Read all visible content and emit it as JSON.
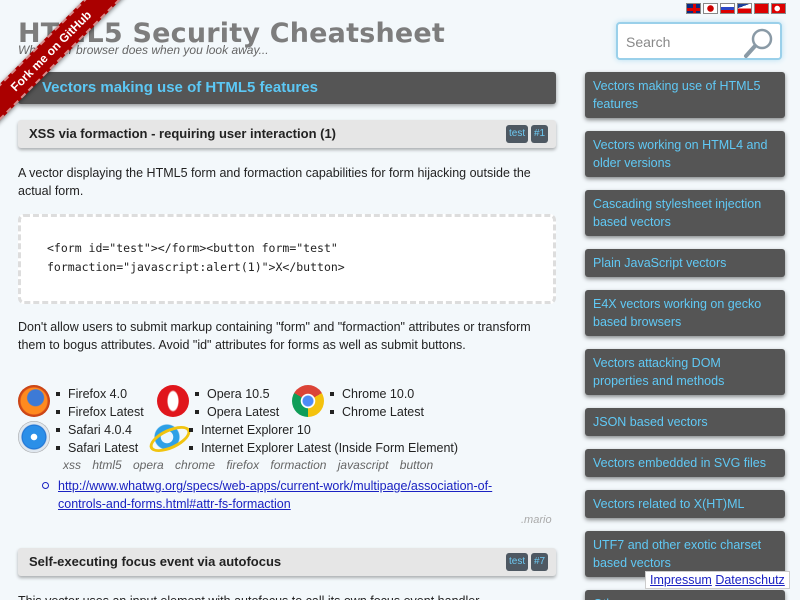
{
  "header": {
    "title": "HTML5 Security Cheatsheet",
    "subtitle": "What your browser does when you look away...",
    "ribbon": "Fork me on GitHub",
    "flags": [
      "English",
      "Japanese",
      "Russian",
      "Czech",
      "Chinese",
      "Turkish"
    ]
  },
  "search": {
    "placeholder": "Search",
    "value": "",
    "icon": "search-icon"
  },
  "main": {
    "section_title": "Vectors making use of HTML5 features",
    "vector1": {
      "title": "XSS via formaction - requiring user interaction (1)",
      "tag_test": "test",
      "tag_id": "#1",
      "description": "A vector displaying the HTML5 form and formaction capabilities for form hijacking outside the actual form.",
      "code_line1": "<form id=\"test\"></form><button form=\"test\"",
      "code_line2": "formaction=\"javascript:alert(1)\">X</button>",
      "advice": "Don't allow users to submit markup containing \"form\" and \"formaction\" attributes or transform them to bogus attributes. Avoid \"id\" attributes for forms as well as submit buttons.",
      "browsers": {
        "firefox": [
          "Firefox 4.0",
          "Firefox Latest"
        ],
        "opera": [
          "Opera 10.5",
          "Opera Latest"
        ],
        "chrome": [
          "Chrome 10.0",
          "Chrome Latest"
        ],
        "safari": [
          "Safari 4.0.4",
          "Safari Latest"
        ],
        "ie": [
          "Internet Explorer 10",
          "Internet Explorer Latest (Inside Form Element)"
        ]
      },
      "keywords": "xss html5 opera chrome firefox formaction javascript button",
      "link_line1": "http://www.whatwg.org/specs/web-apps/current-work/multipage/association-of-",
      "link_line2": "controls-and-forms.html#attr-fs-formaction",
      "author": ".mario"
    },
    "vector2": {
      "title": "Self-executing focus event via autofocus",
      "tag_test": "test",
      "tag_id": "#7",
      "description": "This vector uses an input element with autofocus to call its own focus event handler"
    }
  },
  "sidebar": {
    "items": [
      {
        "label": "Vectors making use of HTML5 features"
      },
      {
        "label": "Vectors working on HTML4 and older versions"
      },
      {
        "label": "Cascading stylesheet injection based vectors"
      },
      {
        "label": "Plain JavaScript vectors"
      },
      {
        "label": "E4X vectors working on gecko based browsers"
      },
      {
        "label": "Vectors attacking DOM properties and methods"
      },
      {
        "label": "JSON based vectors"
      },
      {
        "label": "Vectors embedded in SVG files"
      },
      {
        "label": "Vectors related to X(HT)ML"
      },
      {
        "label": "UTF7 and other exotic charset based vectors"
      },
      {
        "label": "Other"
      }
    ]
  },
  "footer": {
    "impressum": "Impressum",
    "datenschutz": "Datenschutz"
  },
  "colors": {
    "accent": "#5cc8f5",
    "panel": "#555555",
    "link": "#1a22c2",
    "ribbon": "#aa0000"
  }
}
